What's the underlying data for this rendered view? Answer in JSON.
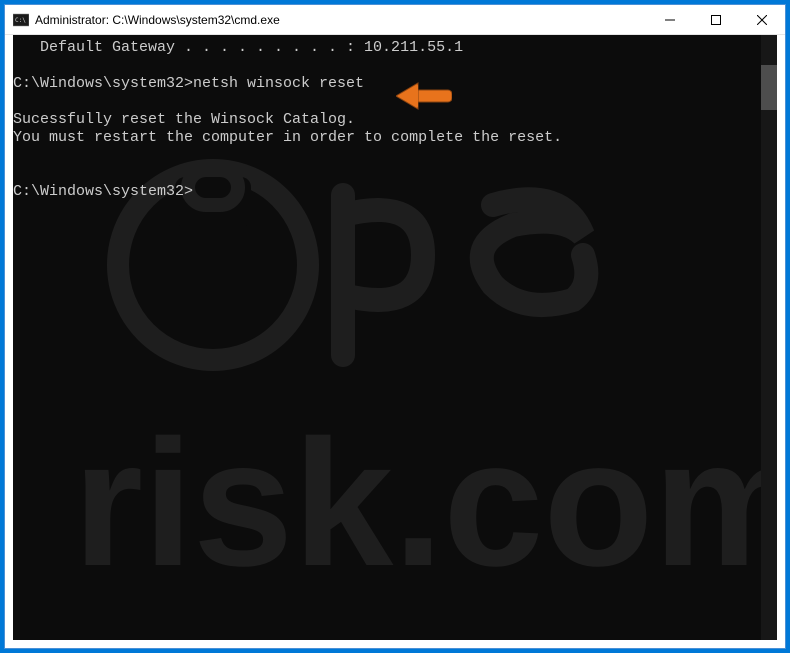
{
  "window": {
    "title": "Administrator: C:\\Windows\\system32\\cmd.exe"
  },
  "terminal": {
    "line1": "   Default Gateway . . . . . . . . . : 10.211.55.1",
    "prompt1_path": "C:\\Windows\\system32>",
    "prompt1_cmd": "netsh winsock reset",
    "output1": "Sucessfully reset the Winsock Catalog.",
    "output2": "You must restart the computer in order to complete the reset.",
    "prompt2_path": "C:\\Windows\\system32>"
  },
  "colors": {
    "border": "#0078d7",
    "terminal_bg": "#0c0c0c",
    "terminal_fg": "#cccccc",
    "arrow": "#e8731c"
  }
}
